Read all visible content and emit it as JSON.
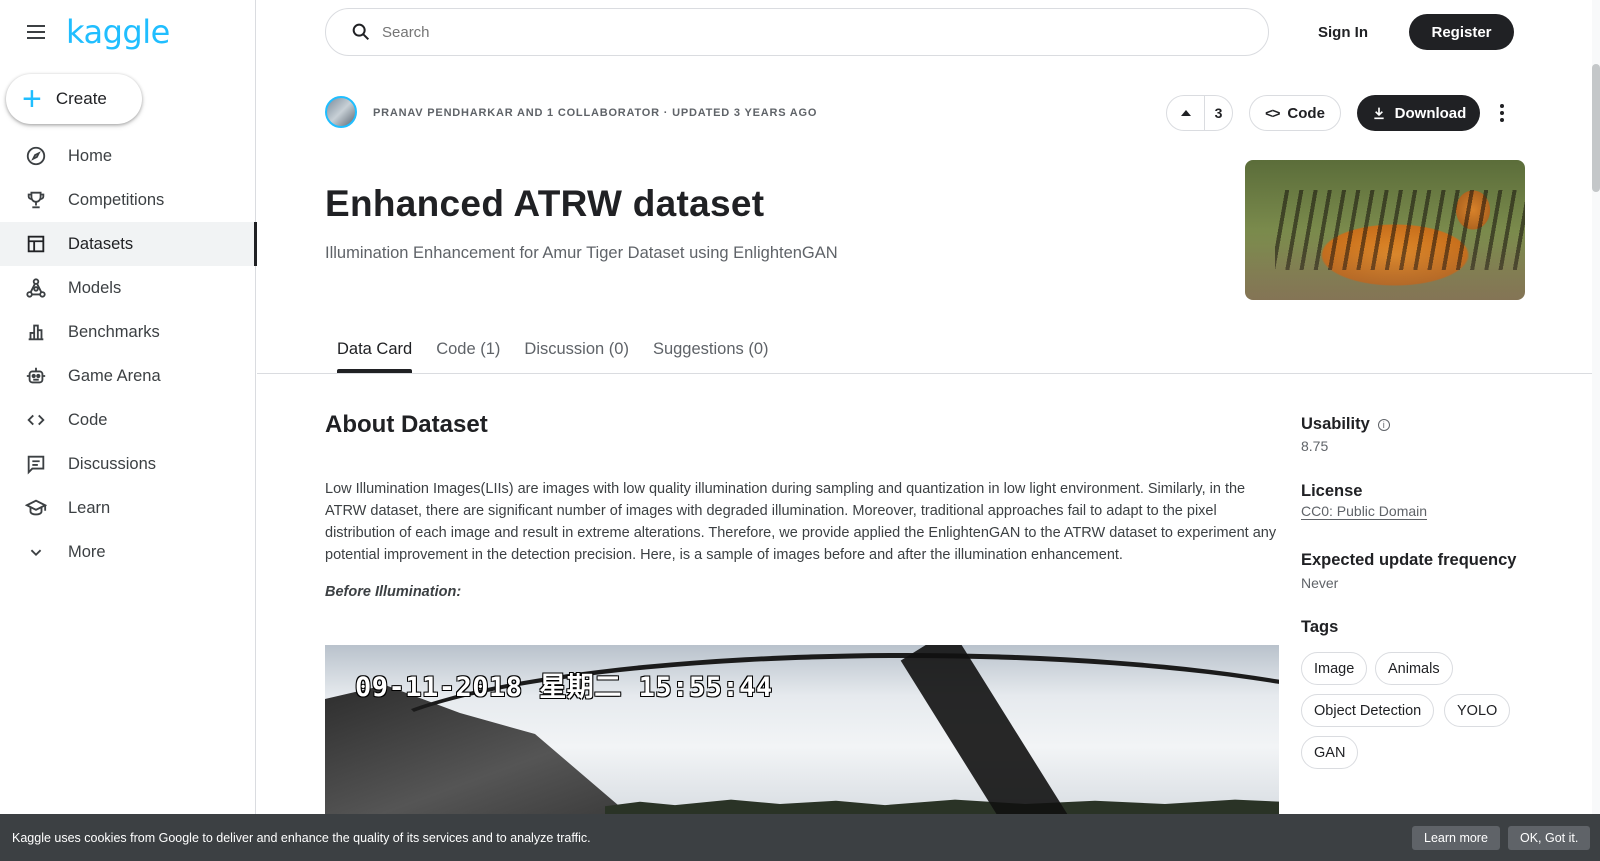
{
  "brand": {
    "logo_text": "kaggle",
    "accent_color": "#20beff"
  },
  "sidebar": {
    "create_label": "Create",
    "items": [
      {
        "label": "Home",
        "icon": "compass-icon"
      },
      {
        "label": "Competitions",
        "icon": "trophy-icon"
      },
      {
        "label": "Datasets",
        "icon": "table-icon",
        "active": true
      },
      {
        "label": "Models",
        "icon": "models-icon"
      },
      {
        "label": "Benchmarks",
        "icon": "bar-chart-icon"
      },
      {
        "label": "Game Arena",
        "icon": "robot-icon"
      },
      {
        "label": "Code",
        "icon": "code-icon"
      },
      {
        "label": "Discussions",
        "icon": "comment-icon"
      },
      {
        "label": "Learn",
        "icon": "school-icon"
      },
      {
        "label": "More",
        "icon": "chevron-down-icon"
      }
    ]
  },
  "topbar": {
    "search_placeholder": "Search",
    "signin_label": "Sign In",
    "register_label": "Register"
  },
  "dataset": {
    "meta": "PRANAV PENDHARKAR AND 1 COLLABORATOR · UPDATED 3 YEARS AGO",
    "vote_count": "3",
    "code_label": "Code",
    "download_label": "Download",
    "title": "Enhanced ATRW dataset",
    "subtitle": "Illumination Enhancement for Amur Tiger Dataset using EnlightenGAN"
  },
  "tabs": [
    {
      "label": "Data Card",
      "active": true
    },
    {
      "label": "Code (1)"
    },
    {
      "label": "Discussion (0)"
    },
    {
      "label": "Suggestions (0)"
    }
  ],
  "content": {
    "heading": "About Dataset",
    "description": "Low Illumination Images(LIIs) are images with low quality illumination during sampling and quantization in low light environment. Similarly, in the ATRW dataset, there are significant number of images with degraded illumination. Moreover, traditional approaches fail to adapt to the pixel distribution of each image and result in extreme alterations. Therefore, we provide applied the EnlightenGAN to the ATRW dataset to experiment any potential improvement in the detection precision. Here, is a sample of images before and after the illumination enhancement.",
    "before_label": "Before Illumination:",
    "sample_timestamp": "09-11-2018 星期二 15:55:44"
  },
  "side": {
    "usability_label": "Usability",
    "usability_value": "8.75",
    "license_label": "License",
    "license_value": "CC0: Public Domain",
    "frequency_label": "Expected update frequency",
    "frequency_value": "Never",
    "tags_label": "Tags",
    "tags": [
      "Image",
      "Animals",
      "Object Detection",
      "YOLO",
      "GAN"
    ]
  },
  "cookie": {
    "text": "Kaggle uses cookies from Google to deliver and enhance the quality of its services and to analyze traffic.",
    "learn_more": "Learn more",
    "ok": "OK, Got it."
  }
}
